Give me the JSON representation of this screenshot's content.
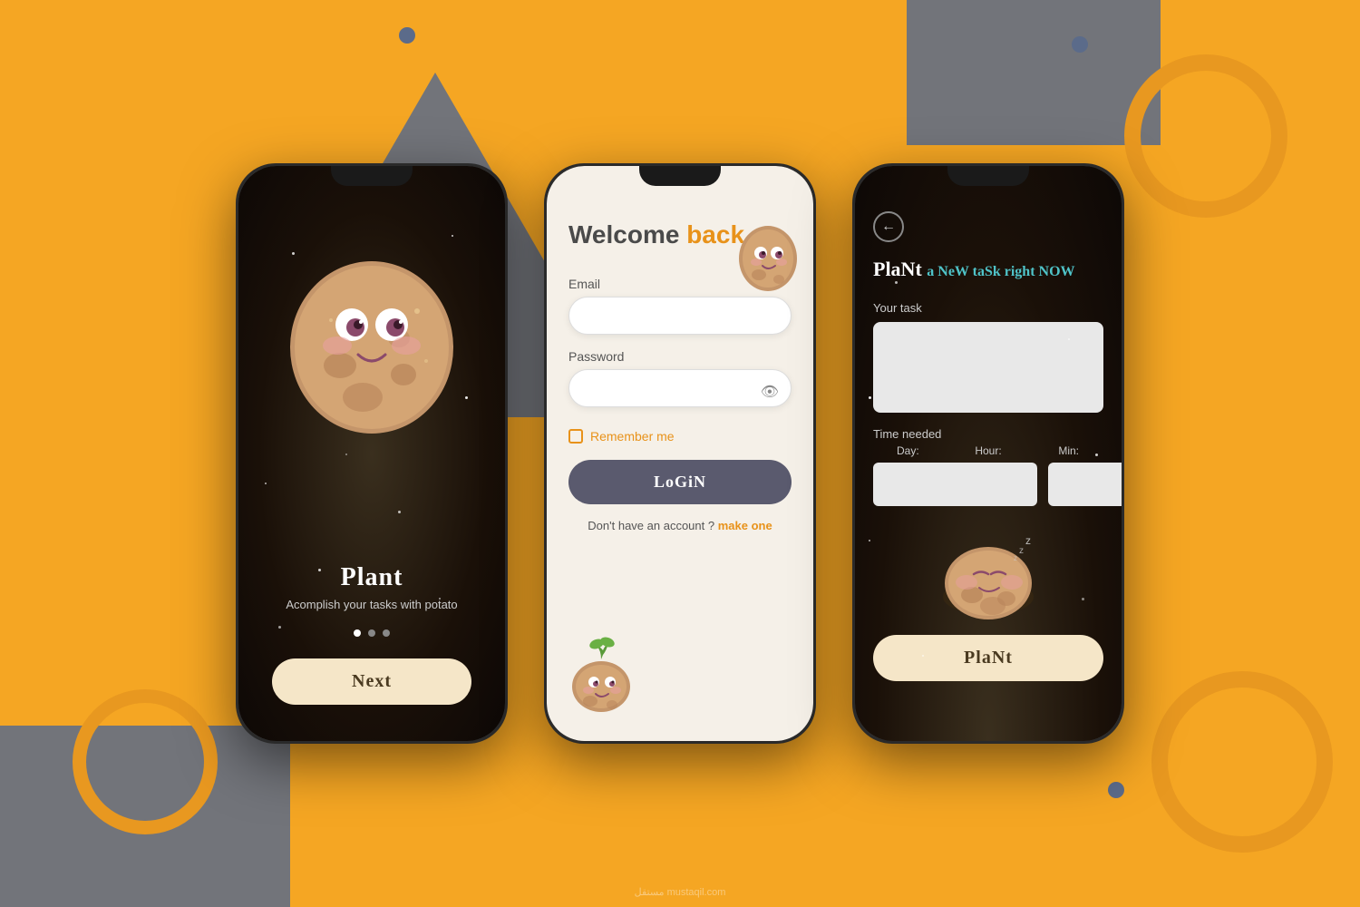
{
  "background": {
    "color": "#F5A623"
  },
  "phone1": {
    "app_title": "Plant",
    "subtitle": "Acomplish your tasks with potato",
    "next_button": "Next",
    "dots": [
      "active",
      "inactive",
      "inactive"
    ]
  },
  "phone2": {
    "welcome_text": "Welcome",
    "back_text": "back",
    "email_label": "Email",
    "email_placeholder": "",
    "password_label": "Password",
    "password_placeholder": "",
    "remember_label": "Remember me",
    "login_button": "LoGiN",
    "no_account_text": "Don't have an account ?",
    "make_one_text": "make one"
  },
  "phone3": {
    "plant_word": "PlaNt",
    "new_task_text": "a NeW taSk right NOW",
    "your_task_label": "Your task",
    "time_needed_label": "Time needed",
    "day_label": "Day:",
    "hour_label": "Hour:",
    "min_label": "Min:",
    "plant_button": "PlaNt",
    "back_icon": "←"
  },
  "watermark": "مستقل  mustaqil.com"
}
